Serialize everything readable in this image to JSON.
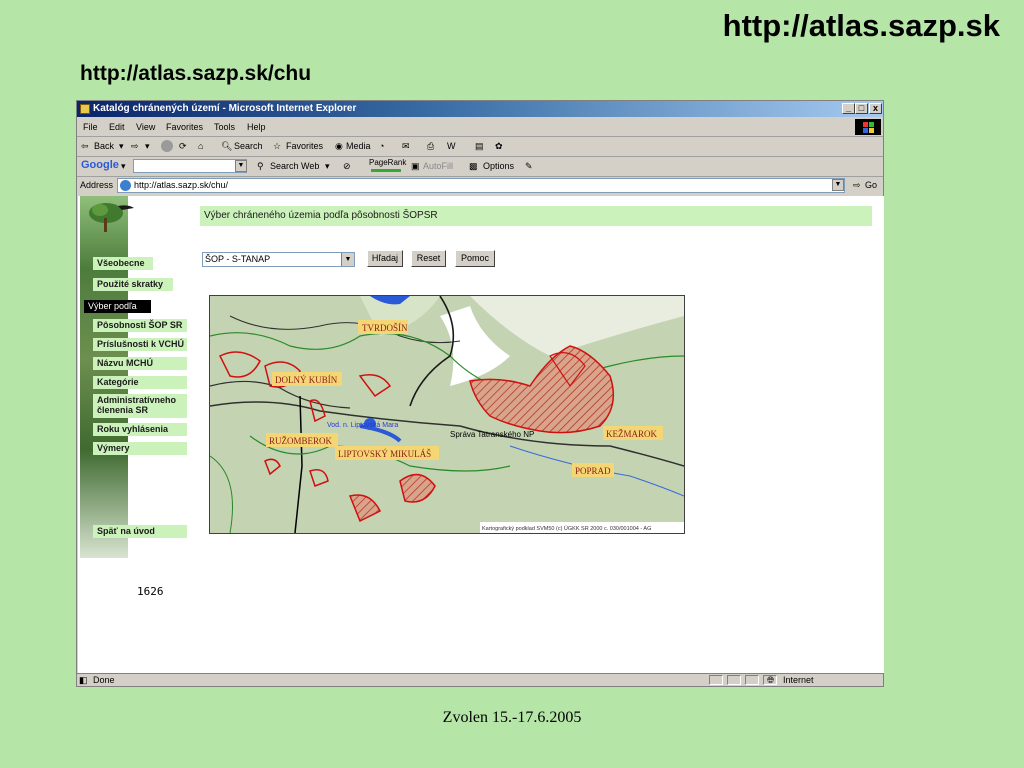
{
  "slide": {
    "title": "http://atlas.sazp.sk",
    "subtitle": "http://atlas.sazp.sk/chu",
    "footer": "Zvolen 15.-17.6.2005"
  },
  "window": {
    "title": "Katalóg chránených území - Microsoft Internet Explorer",
    "controls": [
      "_",
      "□",
      "x"
    ]
  },
  "menubar": [
    "File",
    "Edit",
    "View",
    "Favorites",
    "Tools",
    "Help"
  ],
  "toolbar": {
    "back": "Back",
    "search": "Search",
    "favorites": "Favorites",
    "media": "Media"
  },
  "googlebar": {
    "logo": "Google",
    "search_web": "Search Web",
    "pagerank": "PageRank",
    "autofill": "AutoFill",
    "options": "Options",
    "search_value": ""
  },
  "address": {
    "label": "Address",
    "url": "http://atlas.sazp.sk/chu/",
    "go": "Go"
  },
  "page": {
    "header": "Výber chráneného územia podľa pôsobnosti ŠOPSR",
    "select_value": "ŠOP - S-TANAP",
    "buttons": {
      "search": "Hľadaj",
      "reset": "Reset",
      "help": "Pomoc"
    },
    "counter": "1626",
    "menu": [
      "Všeobecne",
      "Použité skratky",
      "Výber podľa",
      "Pôsobnosti ŠOP SR",
      "Príslušnosti k VCHÚ",
      "Názvu MCHÚ",
      "Kategórie",
      "Administratívneho členenia SR",
      "Roku vyhlásenia",
      "Výmery",
      "Späť na úvod"
    ],
    "map": {
      "towns": [
        "TVRDOŠÍN",
        "DOLNÝ KUBÍN",
        "RUŽOMBEROK",
        "LIPTOVSKÝ MIKULÁŠ",
        "KEŽMAROK",
        "POPRAD"
      ],
      "labels": [
        "Správa Tatranského NP",
        "Vod. n. Liptovská Mara"
      ],
      "credit": "Kartografický podklad SVM50 (c) ÚGKK SR 2000 c. 030/001004 - AG"
    }
  },
  "status": {
    "left": "Done",
    "zone": "Internet"
  }
}
